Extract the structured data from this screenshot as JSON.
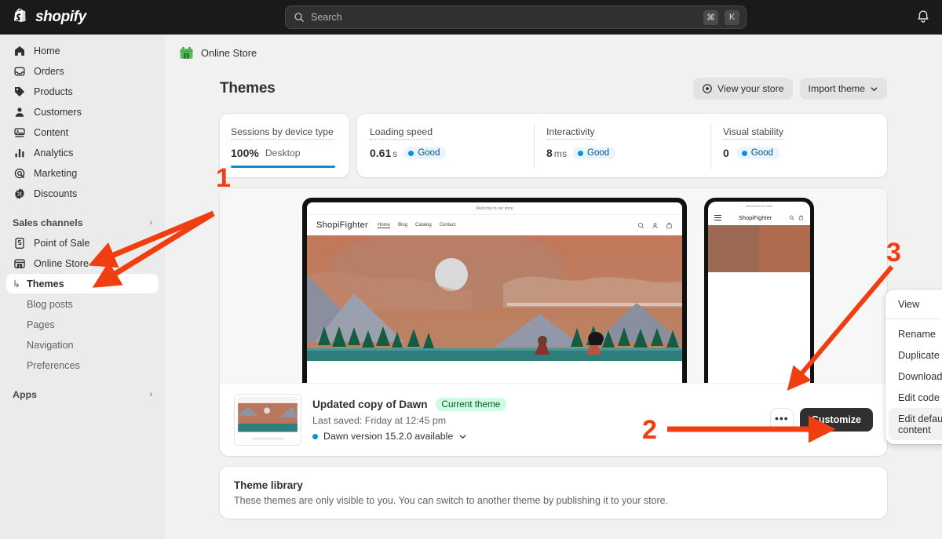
{
  "topbar": {
    "brand": "shopify",
    "brand_icon": "shopify-bag-icon",
    "search": {
      "placeholder": "Search",
      "icon": "search-icon",
      "kbd_mod": "⌘",
      "kbd_key": "K"
    },
    "notifications_icon": "bell-icon"
  },
  "sidebar": {
    "items": [
      {
        "label": "Home",
        "icon": "home-icon"
      },
      {
        "label": "Orders",
        "icon": "orders-inbox-icon"
      },
      {
        "label": "Products",
        "icon": "products-tag-icon"
      },
      {
        "label": "Customers",
        "icon": "customers-person-icon"
      },
      {
        "label": "Content",
        "icon": "content-image-icon"
      },
      {
        "label": "Analytics",
        "icon": "analytics-bars-icon"
      },
      {
        "label": "Marketing",
        "icon": "marketing-target-icon"
      },
      {
        "label": "Discounts",
        "icon": "discounts-badge-icon"
      }
    ],
    "groups": [
      {
        "label": "Sales channels",
        "chevron": "chevron-right-icon"
      }
    ],
    "channels": [
      {
        "label": "Point of Sale",
        "icon": "point-of-sale-icon"
      },
      {
        "label": "Online Store",
        "icon": "online-store-icon"
      }
    ],
    "online_store_children": [
      {
        "label": "Themes",
        "selected": true,
        "branch_icon": "branch-arrow-icon"
      },
      {
        "label": "Blog posts",
        "selected": false
      },
      {
        "label": "Pages",
        "selected": false
      },
      {
        "label": "Navigation",
        "selected": false
      },
      {
        "label": "Preferences",
        "selected": false
      }
    ],
    "apps_group": {
      "label": "Apps",
      "chevron": "chevron-right-icon"
    }
  },
  "breadcrumb": {
    "label": "Online Store",
    "icon": "store-building-icon"
  },
  "page": {
    "title": "Themes",
    "view_store_button": "View your store",
    "view_store_icon": "eye-target-icon",
    "import_theme_button": "Import theme",
    "import_chevron_icon": "chevron-down-icon"
  },
  "metrics": {
    "sessions": {
      "label": "Sessions by device type",
      "value": "100%",
      "device": "Desktop",
      "bar_percent": 100
    },
    "cells": [
      {
        "label": "Loading speed",
        "value": "0.61",
        "unit": "s",
        "status": "Good"
      },
      {
        "label": "Interactivity",
        "value": "8",
        "unit": "ms",
        "status": "Good"
      },
      {
        "label": "Visual stability",
        "value": "0",
        "unit": "",
        "status": "Good"
      }
    ]
  },
  "preview": {
    "desktop": {
      "announcement": "Welcome to our store",
      "brand": "ShopiFighter",
      "links": [
        "Home",
        "Blog",
        "Catalog",
        "Contact"
      ],
      "icons": [
        "search-icon",
        "account-icon",
        "cart-icon"
      ]
    },
    "mobile": {
      "announcement": "Welcome to our store",
      "brand": "ShopiFighter",
      "menu_icon": "hamburger-icon",
      "icons": [
        "search-icon",
        "cart-icon"
      ]
    }
  },
  "theme": {
    "name": "Updated copy of Dawn",
    "badge": "Current theme",
    "last_saved": "Last saved: Friday at 12:45 pm",
    "version_note": "Dawn version 15.2.0 available",
    "version_chevron_icon": "chevron-down-icon",
    "more_actions_icon": "ellipsis-icon",
    "customize_button": "Customize"
  },
  "dropdown": {
    "items": [
      {
        "label": "View",
        "highlighted": false,
        "separator_after": true
      },
      {
        "label": "Rename",
        "highlighted": false
      },
      {
        "label": "Duplicate",
        "highlighted": false
      },
      {
        "label": "Download theme file",
        "highlighted": false
      },
      {
        "label": "Edit code",
        "highlighted": false
      },
      {
        "label": "Edit default theme content",
        "highlighted": true
      }
    ]
  },
  "library": {
    "title": "Theme library",
    "description": "These themes are only visible to you. You can switch to another theme by publishing it to your store."
  },
  "annotations": {
    "color": "#f03e11",
    "markers": [
      {
        "label": "1",
        "targets": [
          "Online Store",
          "Themes"
        ]
      },
      {
        "label": "2",
        "targets": [
          "more-actions-ellipsis-button"
        ]
      },
      {
        "label": "3",
        "targets": [
          "Edit default theme content"
        ]
      }
    ]
  },
  "colors": {
    "topbar_bg": "#1a1a1a",
    "sidebar_bg": "#ebebeb",
    "page_bg": "#f1f1f1",
    "accent_blue": "#0094d5",
    "badge_green_bg": "#cdfee1",
    "badge_green_fg": "#0c5132",
    "annotation_red": "#f03e11",
    "dark_button": "#303030"
  }
}
